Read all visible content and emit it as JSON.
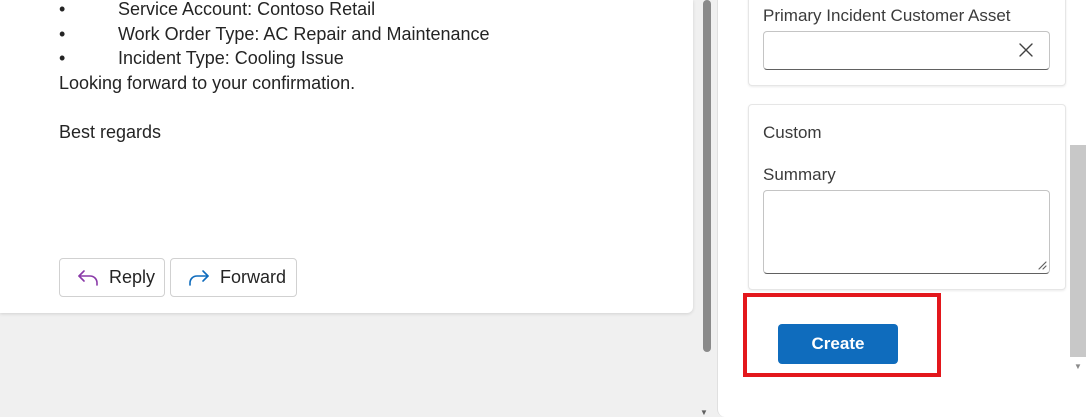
{
  "email": {
    "bullets": [
      "Service Account: Contoso Retail",
      "Work Order Type: AC Repair and Maintenance",
      "Incident Type: Cooling Issue"
    ],
    "bullet_symbol": "•",
    "closing_line": "Looking forward to your confirmation.",
    "signoff": "Best regards",
    "reply_label": "Reply",
    "forward_label": "Forward"
  },
  "panel": {
    "primary_asset_label": "Primary Incident Customer Asset",
    "primary_asset_value": "",
    "custom_section_title": "Custom",
    "summary_label": "Summary",
    "summary_value": "",
    "create_label": "Create"
  },
  "colors": {
    "accent": "#0f6cbd",
    "highlight": "#e3171c",
    "reply_icon": "#8a3aa8",
    "forward_icon": "#0f6cbd"
  },
  "icons": {
    "reply": "reply-arrow-icon",
    "forward": "forward-arrow-icon",
    "clear": "close-icon",
    "resize": "resize-grip-icon"
  }
}
